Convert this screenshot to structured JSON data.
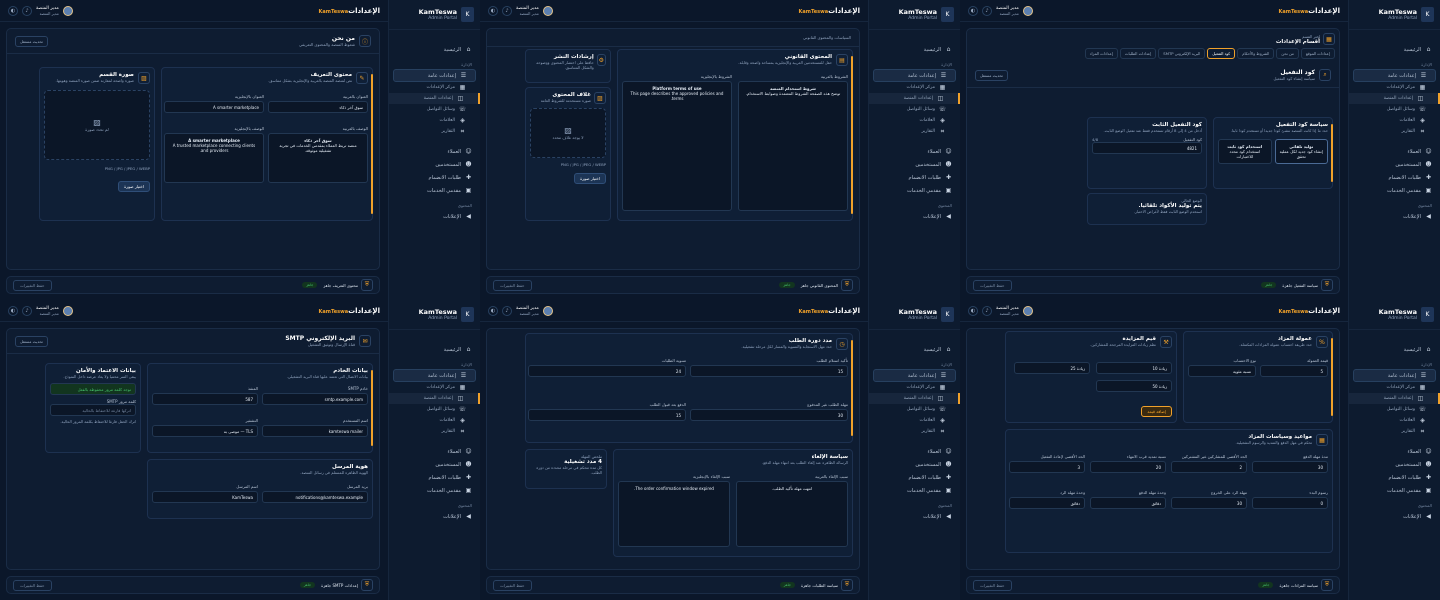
{
  "brand": {
    "name": "KamTeswa",
    "sub": "Admin Portal",
    "logo": "K"
  },
  "header": {
    "title": "الإعدادات",
    "accent": "KamTeswa"
  },
  "user": {
    "name": "مدير المنصة",
    "role": "مدير المنصة"
  },
  "nav": {
    "home": "الرئيسية",
    "section_admin": "الإدارة",
    "general": "إعدادات عامة",
    "subs": [
      "مركز الإعدادات",
      "إعدادات المنصة",
      "وسائل التواصل",
      "العلامات",
      "التقارير"
    ],
    "clients": "العملاء",
    "users": "المستخدمين",
    "join": "طلبات الانضمام",
    "providers": "مقدمي الخدمات",
    "section_other": "المحتوى",
    "ads": "الإعلانات"
  },
  "footer": {
    "save": "حفظ التغييرات",
    "ready_badge": "جاهز"
  },
  "panels": {
    "intro": {
      "top_title": "من نحن",
      "top_sub": "شعوط المنصة والمحتوى التعريفي",
      "chip": "تحديث مستقل",
      "title": "محتوى التعريف",
      "sub": "نص لمنصة المنصة بالعربية والإنجليزية بشكل متناسق.",
      "lbl_ar_title": "العنوان بالعربية",
      "lbl_en_title": "العنوان بالإنجليزية",
      "val_ar_title": "سوق آخر ذكاء",
      "val_en_title": "A smarter marketplace",
      "lbl_ar_desc": "الوصف بالعربية",
      "lbl_en_desc": "الوصف بالإنجليزية",
      "ar_desc_title": "سوق آخر ذكاء",
      "ar_desc": "منصة تربط العملاء بمقدمي الخدمات في تجربة تشغيلية موثوقة.",
      "en_desc_title": "A smarter marketplace",
      "en_desc": "A trusted marketplace connecting clients and providers.",
      "img_title": "صورة القسم",
      "img_sub": "صورة واضحة لمقارنة ضمن صورة المنصة وهويتها.",
      "no_img": "لم تحدد صورة",
      "formats": "PNG / JPG / JPEG / WEBP",
      "upload": "اختيار صورة",
      "ready": "محتوى التعريف جاهز"
    },
    "legal": {
      "top": "السياسات والمحتوى القانوني",
      "title": "المحتوى القانوني",
      "sub": "حقل للمستخدمين العربية والإنجليزية بمساحة واضحة وقابلة.",
      "lbl_ar": "الشروط بالعربية",
      "lbl_en": "الشروط بالإنجليزية",
      "ar_title": "شروط استخدام المنصة",
      "ar_body": "توضح هذه الصفحة الشروط المعتمدة وضوابط الاستخدام.",
      "en_title": "Platform terms of use",
      "en_body": "This page describes the approved policies and terms.",
      "cover_title": "غلاف المحتوى",
      "cover_sub": "صورة مستخدمة للشروط العامة",
      "no_cover": "لا يوجد غلاف محدد",
      "formats": "PNG / JPG / JPEG / WEBP",
      "upload": "اختيار صورة",
      "note_title": "إرشادات النشر",
      "note_sub": "حافظ على اختصار المحتوى ووضوحه والشكل المتناسق.",
      "ready": "المحتوى القانوني جاهز"
    },
    "otp": {
      "tabs": [
        "إعدادات الموقع",
        "من نحن",
        "الشروط والأحكام",
        "كود التفعيل",
        "البريد الإلكتروني SMTP",
        "إعدادات الطلبات",
        "إعدادات المزاد"
      ],
      "top_title": "أقسام الإعدادات",
      "top_sub": "اختر القسم",
      "title": "كود التفعيل",
      "sub": "سياسة إنشاء كود التفعيل",
      "chip": "تحديث مستقل",
      "policy": "سياسة كود التفعيل",
      "policy_sub": "حدد ما إذا كانت المنصة تنشئ كودا جديدا أو تستخدم كودا ثابتا.",
      "opt_auto": "توليد تلقائي",
      "opt_auto_sub": "إنشاء كود جديد لكل عملية تحقق",
      "opt_fixed": "استخدام كود ثابت",
      "opt_fixed_sub": "استخدام كود محدد للاختبارات",
      "fixed": "كود التفعيل الثابت",
      "fixed_sub": "أدخل من 4 إلى 8 أرقام تستخدم فقط عند تفعيل الوضع الثابت.",
      "code_lbl": "كود التفعيل",
      "code_val": "4821",
      "len": "4/8",
      "mode": "الوضع الحالي",
      "mode_val": "يتم توليد الأكواد تلقائيا.",
      "mode_sub": "استخدم الوضع الثابت فقط لأغراض الاختبار.",
      "ready": "سياسة التفعيل جاهزة"
    },
    "smtp": {
      "top_title": "البريد الإلكتروني SMTP",
      "top_sub": "قناة الإرسال وتوثيق التشغيل",
      "chip": "تحديث مستقل",
      "server": "بيانات الخادم",
      "server_sub": "بيانات الاتصال التي تعتمد عليها قناة البريد التشغيلي.",
      "lbl_host": "خادم SMTP",
      "host": "smtp.example.com",
      "lbl_port": "المنفذ",
      "port": "587",
      "lbl_user": "اسم المستخدم",
      "user": "kamteswa mailer",
      "lbl_enc": "التشفير",
      "enc": "TLS — موصى به",
      "cred": "بيانات الاعتماد والأمان",
      "cred_sub": "يبقى السر محميا ولا يعاد عرضه داخل النموذج.",
      "saved": "توجد كلمة مرور محفوظة بالفعل",
      "lbl_pass": "كلمة مرور SMTP",
      "pass_ph": "اتركها فارغة للاحتفاظ بالحالية",
      "hint": "اترك الحقل فارغا للاحتفاظ بكلمة المرور الحالية.",
      "sender": "هوية المرسل",
      "sender_sub": "الهوية الظاهرة للمستلم في رسائل المنصة.",
      "lbl_from": "بريد المرسل",
      "from": "notifications@kamteswa.example",
      "lbl_name": "اسم المرسل",
      "name": "KamTeswa",
      "ready": "إعدادات SMTP جاهزة"
    },
    "orders": {
      "title": "مدد دورة الطلب",
      "sub": "حدد مهل الاستجابة والتسوية والمسار لكل مرحلة تشغيلية.",
      "f1": "تأكيد استلام الطلب",
      "v1": "15",
      "u1": "دقائق",
      "f2": "تسوية الطلبات",
      "v2": "24",
      "u2": "ساعات",
      "f3": "مهلة الطلب غير المدفوع",
      "v3": "30",
      "u3": "دقائق",
      "f4": "الدفع بعد قبول الطلب",
      "v4": "15",
      "u4": "دقائق",
      "cancel": "سياسة الإلغاء",
      "cancel_sub": "الرسالة الظاهرة عند إلغاء الطلب بعد انتهاء مهلة الدفع.",
      "lbl_ar": "سبب الإلغاء بالعربية",
      "lbl_en": "سبب الإلغاء بالإنجليزية",
      "ar": "انتهت مهلة تأكيد الطلب.",
      "en": "The order confirmation window expired.",
      "sum_title": "ملخص المهلة",
      "sum_val": "4 مدد تشغيلية",
      "sum_sub": "كل مدة تتحكم في مرحلة محددة من دورة الطلب.",
      "ready": "سياسة الطلبات جاهزة"
    },
    "auction": {
      "comm": "عمولة المزاد",
      "comm_sub": "حدد طريقة احتساب عمولة المزادات المكتملة.",
      "lbl_val": "قيمة العمولة",
      "val": "5",
      "lbl_type": "نوع الاحتساب",
      "type": "نسبة مئوية",
      "inc": "قيم المزايدة",
      "inc_sub": "نظم زيادات المزايدة المرجحة للمشاركين.",
      "r1": "10",
      "r2": "25",
      "r3": "50",
      "rl": "زيادة",
      "add": "إضافة قيمة",
      "timing": "مواعيد وسياسات المزاد",
      "timing_sub": "تحكم في مهل الدفع والتمديد والرسوم التشغيلية.",
      "t1": "مدة مهلة الدفع",
      "t1v": "30",
      "t2": "الحد الأقصى للمشاركين غير المشتركين",
      "t2v": "2",
      "t3": "نسبة تمديد قرب الانتهاء",
      "t3v": "20",
      "t4": "الحد الأقصى لإعادة التفعيل",
      "t4v": "3",
      "t5": "رسوم البدء",
      "t5v": "0",
      "t6": "مهلة الرد على الخروج",
      "t6v": "30",
      "t7": "وحدة مهلة الدفع",
      "t7v": "دقائق",
      "t8": "وحدة مهلة الرد",
      "t8v": "دقائق",
      "ready": "سياسة المزادات جاهزة"
    }
  }
}
